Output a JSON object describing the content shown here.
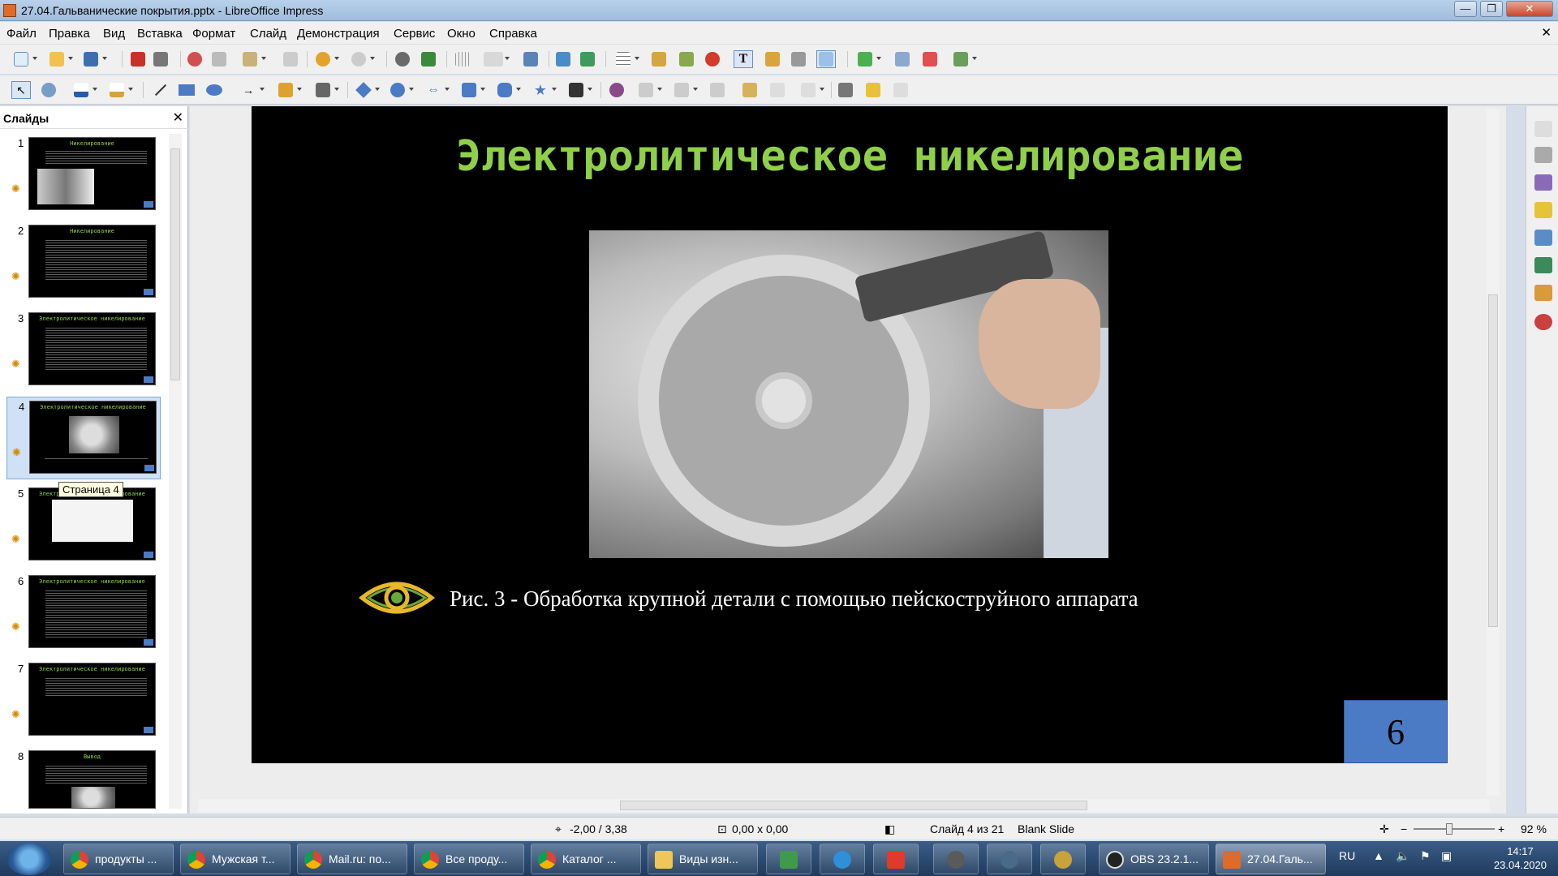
{
  "window": {
    "title": "27.04.Гальванические покрытия.pptx - LibreOffice Impress"
  },
  "menu": [
    "Файл",
    "Правка",
    "Вид",
    "Вставка",
    "Формат",
    "Слайд",
    "Демонстрация",
    "Сервис",
    "Окно",
    "Справка"
  ],
  "slides_pane": {
    "header": "Слайды",
    "tooltip": "Страница 4",
    "thumbnails": [
      {
        "num": "1",
        "title": "Никелирование"
      },
      {
        "num": "2",
        "title": "Никелирование"
      },
      {
        "num": "3",
        "title": "Электролитическое никелирование"
      },
      {
        "num": "4",
        "title": "Электролитическое никелирование"
      },
      {
        "num": "5",
        "title": "Электролитическое никелирование"
      },
      {
        "num": "6",
        "title": "Электролитическое никелирование"
      },
      {
        "num": "7",
        "title": "Электролитическое никелирование"
      },
      {
        "num": "8",
        "title": "Вывод"
      }
    ]
  },
  "slide": {
    "title": "Электролитическое никелирование",
    "caption": "Рис. 3 - Обработка крупной детали с помощью пейскоструйного аппарата",
    "page_number": "6"
  },
  "status": {
    "position": "-2,00 / 3,38",
    "size": "0,00 x 0,00",
    "slide_info": "Слайд 4 из 21",
    "layout": "Blank Slide",
    "zoom": "92 %"
  },
  "taskbar": {
    "tasks": [
      {
        "label": "продукты ...",
        "icon": "chrome-icon"
      },
      {
        "label": "Мужская т...",
        "icon": "chrome-icon"
      },
      {
        "label": "Mail.ru: по...",
        "icon": "chrome-icon"
      },
      {
        "label": "Все проду...",
        "icon": "chrome-icon"
      },
      {
        "label": "Каталог ...",
        "icon": "chrome-icon"
      },
      {
        "label": "Виды изн...",
        "icon": "folder-icon"
      },
      {
        "label": "OBS 23.2.1...",
        "icon": "obs-icon"
      },
      {
        "label": "27.04.Галь...",
        "icon": "impress-icon"
      }
    ],
    "lang": "RU",
    "time": "14:17",
    "date": "23.04.2020"
  },
  "colors": {
    "slide_title": "#8fcf4a",
    "page_box": "#4a7bc4",
    "eye_icon": "#e8b82a"
  }
}
